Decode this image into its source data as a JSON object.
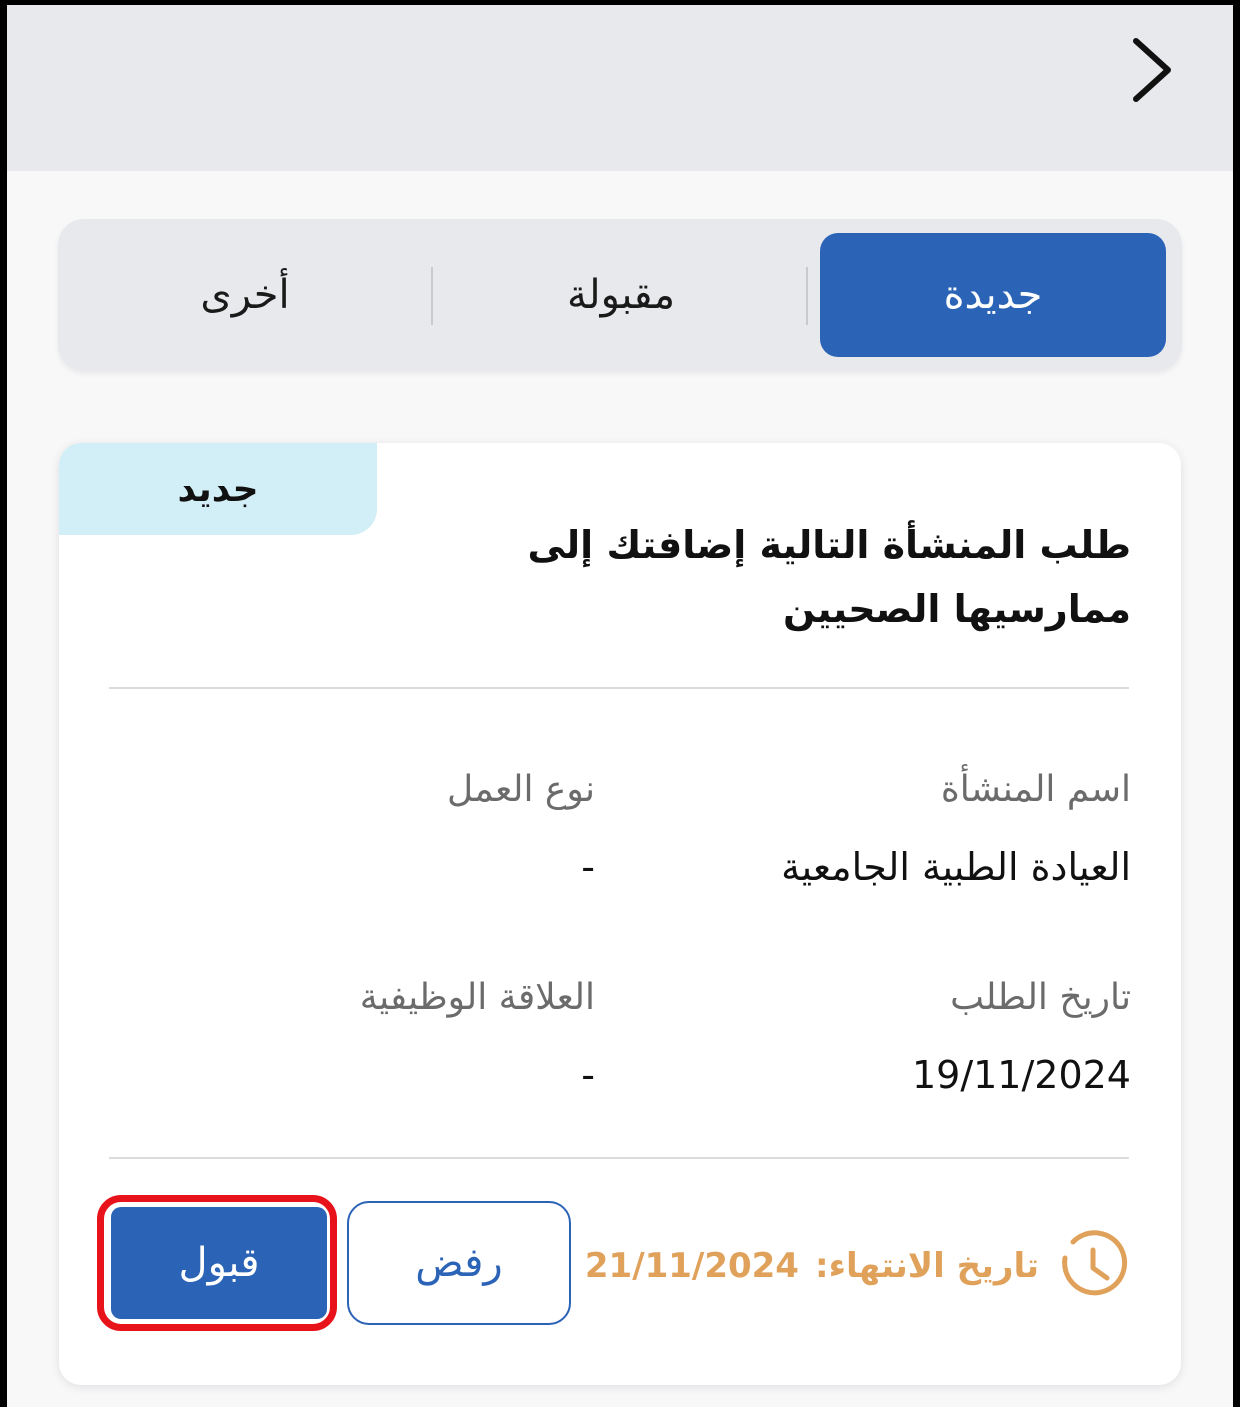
{
  "tabs": [
    {
      "label": "جديدة",
      "active": true
    },
    {
      "label": "مقبولة",
      "active": false
    },
    {
      "label": "أخرى",
      "active": false
    }
  ],
  "card": {
    "badge": "جديد",
    "title": "طلب المنشأة التالية إضافتك إلى ممارسيها الصحيين",
    "fields": {
      "facility_name_label": "اسم المنشأة",
      "facility_name_value": "العيادة الطبية الجامعية",
      "work_type_label": "نوع العمل",
      "work_type_value": "-",
      "request_date_label": "تاريخ الطلب",
      "request_date_value": "19/11/2024",
      "job_relation_label": "العلاقة الوظيفية",
      "job_relation_value": "-"
    },
    "expiry_label": "تاريخ الانتهاء:",
    "expiry_value": "21/11/2024",
    "reject_label": "رفض",
    "accept_label": "قبول"
  },
  "colors": {
    "primary": "#2b63b6",
    "badge_bg": "#d2eef6",
    "expiry": "#e0a15a",
    "highlight": "#e8121a"
  },
  "icons": [
    "chevron-right-icon",
    "clock-icon"
  ]
}
